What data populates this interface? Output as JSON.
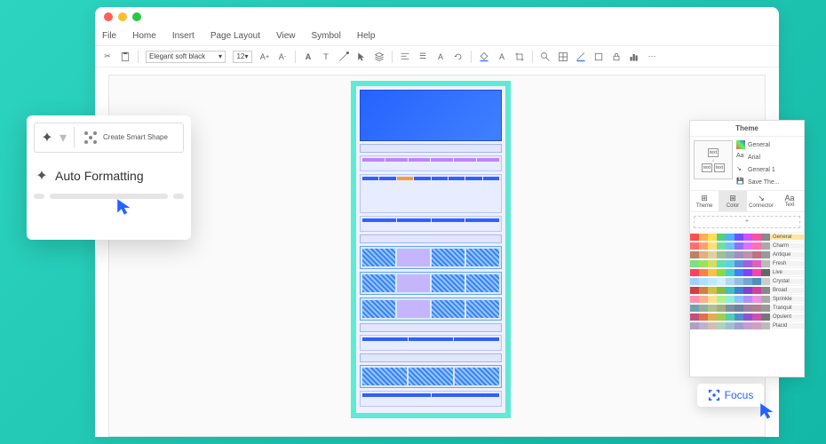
{
  "menu": [
    "File",
    "Home",
    "Insert",
    "Page Layout",
    "View",
    "Symbol",
    "Help"
  ],
  "toolbar": {
    "font": "Elegant soft black",
    "size": "12"
  },
  "popup": {
    "create": "Create Smart Shape",
    "auto": "Auto Formatting"
  },
  "theme": {
    "title": "Theme",
    "opts": [
      "General",
      "Arial",
      "General 1",
      "Save The..."
    ],
    "tabs": [
      "Theme",
      "Color",
      "Connector",
      "Text"
    ],
    "swatches": [
      "General",
      "Charm",
      "Antique",
      "Fresh",
      "Live",
      "Crystal",
      "Broad",
      "Sprinkle",
      "Tranquil",
      "Opulent",
      "Placid"
    ]
  },
  "focus": "Focus",
  "swatch_colors": [
    [
      "#ff5050",
      "#ffb050",
      "#ffe050",
      "#50d080",
      "#50b0ff",
      "#7050ff",
      "#d050ff",
      "#ff50a0",
      "#888888"
    ],
    [
      "#ff7070",
      "#ffa070",
      "#ffe070",
      "#70e0a0",
      "#70c0ff",
      "#9070ff",
      "#e070ff",
      "#ff70b0",
      "#aaaaaa"
    ],
    [
      "#c08060",
      "#e0b080",
      "#e0d0a0",
      "#a0c090",
      "#90b0c0",
      "#a090c0",
      "#c090b0",
      "#c07080",
      "#999999"
    ],
    [
      "#80e080",
      "#a0e060",
      "#d0e060",
      "#60e0b0",
      "#60d0e0",
      "#6090e0",
      "#a060e0",
      "#e060c0",
      "#bbbbbb"
    ],
    [
      "#ff4060",
      "#ff8040",
      "#ffc040",
      "#80e040",
      "#40d0d0",
      "#4080ff",
      "#8040ff",
      "#ff40b0",
      "#666666"
    ],
    [
      "#a0d0ff",
      "#b0e0ff",
      "#c0e8ff",
      "#d0f0ff",
      "#b0d8f0",
      "#90c0e0",
      "#70a8d0",
      "#5090c0",
      "#cccccc"
    ],
    [
      "#d04040",
      "#d08040",
      "#d0c040",
      "#80c040",
      "#40c0c0",
      "#4080d0",
      "#8040d0",
      "#d040a0",
      "#888888"
    ],
    [
      "#ff90b0",
      "#ffb090",
      "#ffe090",
      "#b0f090",
      "#90f0d0",
      "#90c0ff",
      "#b090ff",
      "#f090e0",
      "#aaaaaa"
    ],
    [
      "#70a0b0",
      "#90b0a0",
      "#b0c090",
      "#a0b080",
      "#8090a0",
      "#7080a0",
      "#a080a0",
      "#b08090",
      "#999999"
    ],
    [
      "#c05080",
      "#e07050",
      "#e0b050",
      "#a0d050",
      "#50d0b0",
      "#5090d0",
      "#9050d0",
      "#d050b0",
      "#777777"
    ],
    [
      "#b0a0c0",
      "#c0b0d0",
      "#d0c0b0",
      "#b0d0c0",
      "#a0c0d0",
      "#a0a0d0",
      "#c0a0d0",
      "#d0a0c0",
      "#bbbbbb"
    ]
  ]
}
